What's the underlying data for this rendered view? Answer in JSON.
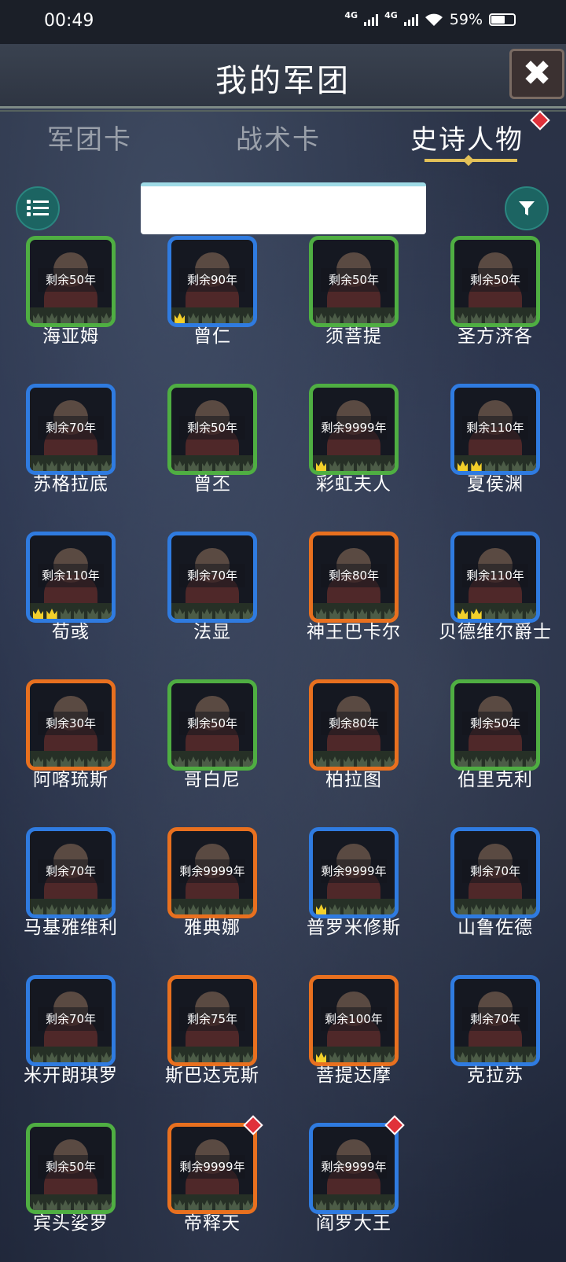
{
  "status_bar": {
    "time": "00:49",
    "net1": "4G",
    "net2": "4G",
    "battery": "59%"
  },
  "header": {
    "title": "我的军团",
    "close_label": "✖"
  },
  "tabs": [
    {
      "label": "军团卡",
      "active": false
    },
    {
      "label": "战术卡",
      "active": false
    },
    {
      "label": "史诗人物",
      "active": true
    }
  ],
  "search": {
    "value": "",
    "placeholder": ""
  },
  "colors": {
    "green": "#4fae42",
    "blue": "#2f7be0",
    "orange": "#e8701f",
    "gold": "#f2cf2a",
    "teal": "#1c6462",
    "alert": "#e0313a"
  },
  "characters": [
    {
      "name": "海亚姆",
      "remain": "剩余50年",
      "frame": "green",
      "stars": 0,
      "new": false
    },
    {
      "name": "曾仁",
      "remain": "剩余90年",
      "frame": "blue",
      "stars": 1,
      "new": false
    },
    {
      "name": "须菩提",
      "remain": "剩余50年",
      "frame": "green",
      "stars": 0,
      "new": false
    },
    {
      "name": "圣方济各",
      "remain": "剩余50年",
      "frame": "green",
      "stars": 0,
      "new": false
    },
    {
      "name": "苏格拉底",
      "remain": "剩余70年",
      "frame": "blue",
      "stars": 0,
      "new": false
    },
    {
      "name": "曾丕",
      "remain": "剩余50年",
      "frame": "green",
      "stars": 0,
      "new": false
    },
    {
      "name": "彩虹夫人",
      "remain": "剩余9999年",
      "frame": "green",
      "stars": 1,
      "new": false
    },
    {
      "name": "夏侯渊",
      "remain": "剩余110年",
      "frame": "blue",
      "stars": 2,
      "new": false
    },
    {
      "name": "荀彧",
      "remain": "剩余110年",
      "frame": "blue",
      "stars": 2,
      "new": false
    },
    {
      "name": "法显",
      "remain": "剩余70年",
      "frame": "blue",
      "stars": 0,
      "new": false
    },
    {
      "name": "神王巴卡尔",
      "remain": "剩余80年",
      "frame": "orange",
      "stars": 0,
      "new": false
    },
    {
      "name": "贝德维尔爵士",
      "remain": "剩余110年",
      "frame": "blue",
      "stars": 2,
      "new": false
    },
    {
      "name": "阿喀琉斯",
      "remain": "剩余30年",
      "frame": "orange",
      "stars": 0,
      "new": false
    },
    {
      "name": "哥白尼",
      "remain": "剩余50年",
      "frame": "green",
      "stars": 0,
      "new": false
    },
    {
      "name": "柏拉图",
      "remain": "剩余80年",
      "frame": "orange",
      "stars": 0,
      "new": false
    },
    {
      "name": "伯里克利",
      "remain": "剩余50年",
      "frame": "green",
      "stars": 0,
      "new": false
    },
    {
      "name": "马基雅维利",
      "remain": "剩余70年",
      "frame": "blue",
      "stars": 0,
      "new": false
    },
    {
      "name": "雅典娜",
      "remain": "剩余9999年",
      "frame": "orange",
      "stars": 0,
      "new": false
    },
    {
      "name": "普罗米修斯",
      "remain": "剩余9999年",
      "frame": "blue",
      "stars": 1,
      "new": false
    },
    {
      "name": "山鲁佐德",
      "remain": "剩余70年",
      "frame": "blue",
      "stars": 0,
      "new": false
    },
    {
      "name": "米开朗琪罗",
      "remain": "剩余70年",
      "frame": "blue",
      "stars": 0,
      "new": false
    },
    {
      "name": "斯巴达克斯",
      "remain": "剩余75年",
      "frame": "orange",
      "stars": 0,
      "new": false
    },
    {
      "name": "菩提达摩",
      "remain": "剩余100年",
      "frame": "orange",
      "stars": 1,
      "new": false
    },
    {
      "name": "克拉苏",
      "remain": "剩余70年",
      "frame": "blue",
      "stars": 0,
      "new": false
    },
    {
      "name": "宾头娑罗",
      "remain": "剩余50年",
      "frame": "green",
      "stars": 0,
      "new": false
    },
    {
      "name": "帝释天",
      "remain": "剩余9999年",
      "frame": "orange",
      "stars": 0,
      "new": true
    },
    {
      "name": "阎罗大王",
      "remain": "剩余9999年",
      "frame": "blue",
      "stars": 0,
      "new": true
    }
  ]
}
